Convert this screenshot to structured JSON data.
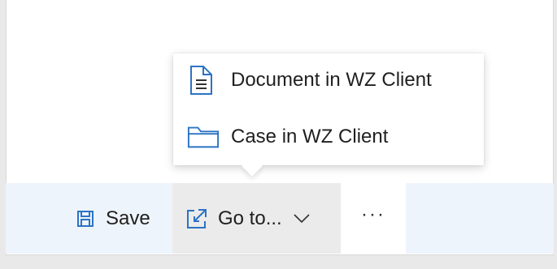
{
  "colors": {
    "accent": "#2b73c4",
    "icon_dark": "#323130"
  },
  "flyout": {
    "items": [
      {
        "label": "Document in WZ Client",
        "icon": "document-icon"
      },
      {
        "label": "Case in WZ Client",
        "icon": "folder-icon"
      }
    ]
  },
  "commandbar": {
    "save_label": "Save",
    "save_icon": "save-disk-icon",
    "goto_label": "Go to...",
    "goto_icon": "open-external-icon",
    "goto_chevron_icon": "chevron-down-icon",
    "more_label": "···"
  }
}
